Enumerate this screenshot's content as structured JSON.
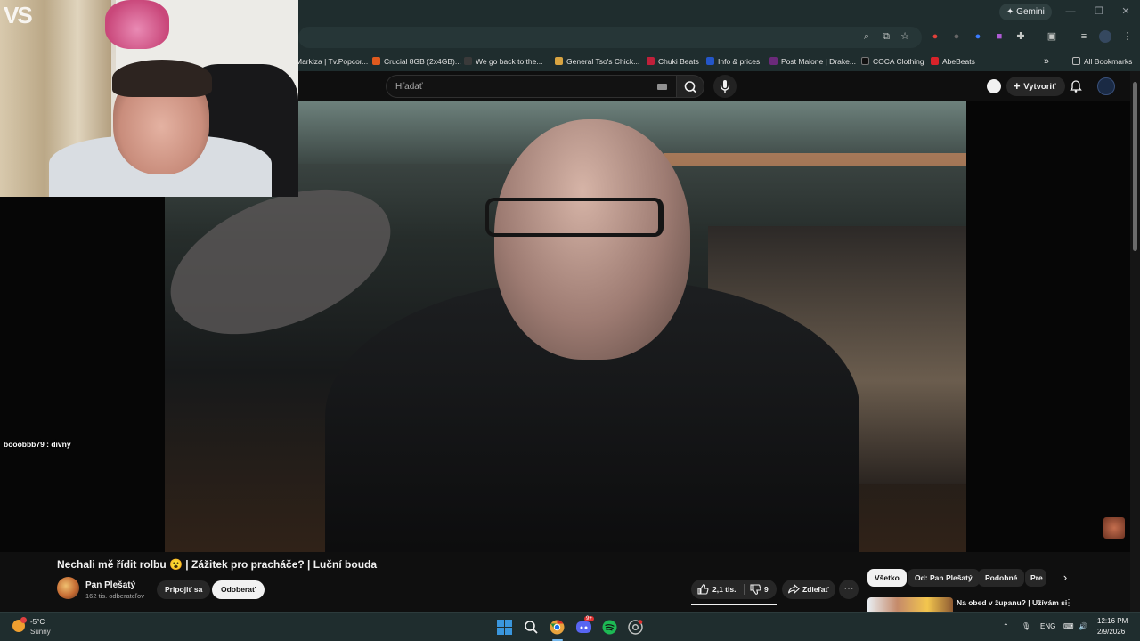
{
  "browser": {
    "gemini_label": "Gemini",
    "window_controls": {
      "minimize": "—",
      "restore": "❐",
      "close": "✕"
    },
    "bookmarks": [
      {
        "label": "Markiza | Tv.Popcor...",
        "color": "#2c3b3c"
      },
      {
        "label": "Crucial 8GB (2x4GB)...",
        "color": "#e05a1e"
      },
      {
        "label": "We go back to the...",
        "color": "#2e2e2e"
      },
      {
        "label": "General Tso's Chick...",
        "color": "#d9a441"
      },
      {
        "label": "Chuki Beats",
        "color": "#c0203a"
      },
      {
        "label": "Info & prices",
        "color": "#2456c9"
      },
      {
        "label": "Post Malone | Drake...",
        "color": "#6b2a7a"
      },
      {
        "label": "COCA Clothing",
        "color": "#1a1a1a"
      },
      {
        "label": "AbeBeats",
        "color": "#d8232a"
      }
    ],
    "bookmarks_overflow": "»",
    "all_bookmarks_label": "All Bookmarks"
  },
  "youtube": {
    "search_placeholder": "Hľadať",
    "create_label": "Vytvoriť",
    "video": {
      "title": "Nechali mě řídit rolbu 😮 | Zážitek pro pracháče? | Luční bouda",
      "chat_message": "booobbb79 : divny",
      "cam_logo": "VS"
    },
    "channel": {
      "name": "Pan Plešatý",
      "subscribers": "162 tis. odberateľov",
      "join_label": "Pripojiť sa",
      "subscribe_label": "Odoberať"
    },
    "actions": {
      "likes": "2,1 tis.",
      "dislikes": "9",
      "share_label": "Zdieľať",
      "more_label": "⋯"
    },
    "chips": [
      "Všetko",
      "Od: Pan Plešatý",
      "Podobné",
      "Pre"
    ],
    "chips_next": "›",
    "recommendation": {
      "title": "Na obed v županu? | Užívám si"
    }
  },
  "taskbar": {
    "weather_temp": "-5°C",
    "weather_condition": "Sunny",
    "language": "ENG",
    "time": "12:16 PM",
    "date": "2/9/2026",
    "apps": [
      {
        "name": "windows-start",
        "color": "#3a96dd"
      },
      {
        "name": "search",
        "color": "#f1f1f1"
      },
      {
        "name": "chrome",
        "color": "#e8a33d"
      },
      {
        "name": "discord",
        "color": "#5865f2"
      },
      {
        "name": "spotify",
        "color": "#1db954"
      },
      {
        "name": "chrome-alt",
        "color": "#9aa0a6"
      }
    ],
    "discord_badge": "9+"
  }
}
